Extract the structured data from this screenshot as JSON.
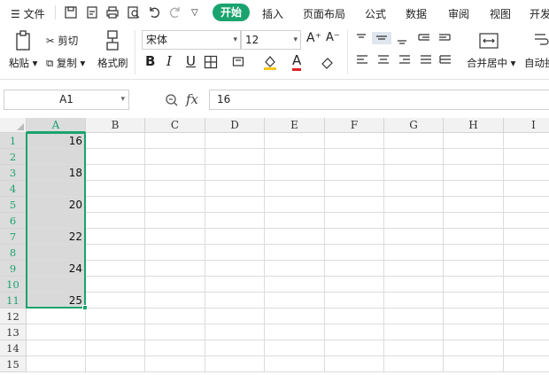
{
  "menu": {
    "hamburger_label": "文件",
    "tabs": [
      "开始",
      "插入",
      "页面布局",
      "公式",
      "数据",
      "审阅",
      "视图",
      "开发"
    ]
  },
  "ribbon": {
    "paste": "粘贴",
    "cut": "剪切",
    "copy": "复制",
    "format_painter": "格式刷",
    "font_name": "宋体",
    "font_size": "12",
    "bold": "B",
    "italic": "I",
    "underline": "U",
    "font_color_letter": "A",
    "grow_font": "A⁺",
    "shrink_font": "A⁻",
    "merge_center": "合并居中",
    "auto_wrap": "自动换"
  },
  "formula_bar": {
    "cell_ref": "A1",
    "fx": "fx",
    "value": "16"
  },
  "columns": [
    "A",
    "B",
    "C",
    "D",
    "E",
    "F",
    "G",
    "H",
    "I"
  ],
  "rows": [
    "1",
    "2",
    "3",
    "4",
    "5",
    "6",
    "7",
    "8",
    "9",
    "10",
    "11",
    "12",
    "13",
    "14",
    "15"
  ],
  "cells": {
    "A1": "16",
    "A3": "18",
    "A5": "20",
    "A7": "22",
    "A9": "24",
    "A11": "25"
  },
  "colors": {
    "accent": "#1aa36e",
    "selection_fill": "#d9d9d9",
    "selection_border": "#1aa36e",
    "header_active_text": "#1aa36e"
  }
}
